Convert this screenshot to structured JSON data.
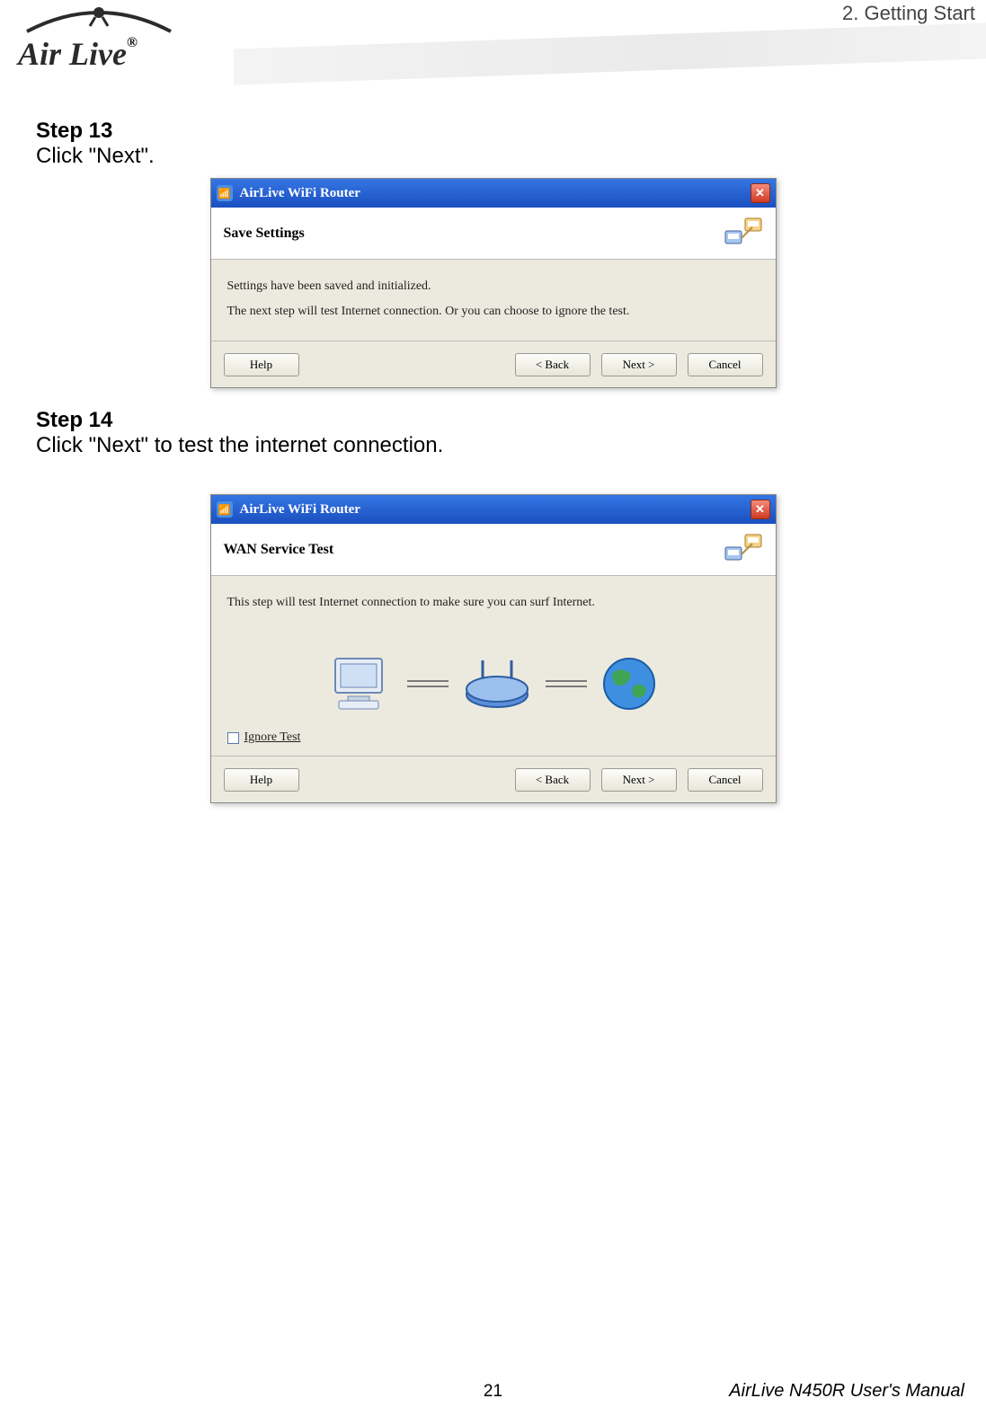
{
  "header": {
    "logo_text": "Air Live",
    "trademark": "®",
    "chapter": "2. Getting Start"
  },
  "step13": {
    "heading": "Step 13",
    "instruction": "Click \"Next\".",
    "dialog": {
      "title": "AirLive WiFi Router",
      "banner_title": "Save Settings",
      "line1": "Settings have been saved and initialized.",
      "line2": "The next step will test Internet connection. Or you can choose to ignore the test.",
      "buttons": {
        "help": "Help",
        "back": "< Back",
        "next": "Next >",
        "cancel": "Cancel"
      }
    }
  },
  "step14": {
    "heading": "Step 14",
    "instruction": "Click \"Next\" to test the internet connection.",
    "dialog": {
      "title": "AirLive WiFi Router",
      "banner_title": "WAN Service Test",
      "line1": "This step will test Internet connection to make sure you can surf Internet.",
      "ignore_label": "Ignore Test",
      "buttons": {
        "help": "Help",
        "back": "< Back",
        "next": "Next >",
        "cancel": "Cancel"
      }
    }
  },
  "footer": {
    "page_number": "21",
    "manual": "AirLive N450R User's Manual"
  }
}
